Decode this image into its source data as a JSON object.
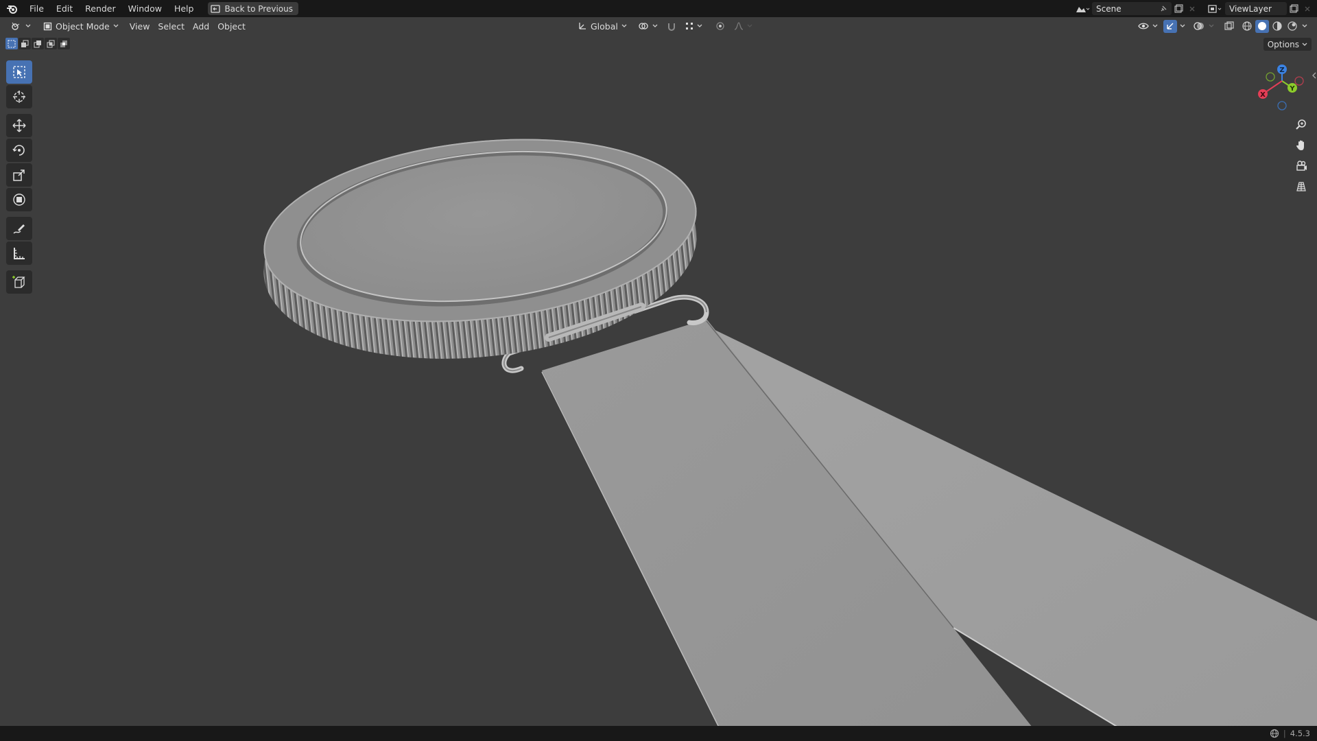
{
  "menu": {
    "items": [
      "File",
      "Edit",
      "Render",
      "Window",
      "Help"
    ],
    "back_label": "Back to Previous"
  },
  "topbar_right": {
    "scene": "Scene",
    "view_layer": "ViewLayer"
  },
  "header": {
    "mode": "Object Mode",
    "menus": [
      "View",
      "Select",
      "Add",
      "Object"
    ],
    "orientation": "Global",
    "options_label": "Options"
  },
  "toolbar": {
    "tools": [
      "select-box",
      "cursor",
      "move",
      "rotate",
      "scale",
      "transform",
      "annotate",
      "measure",
      "add-cube"
    ],
    "active": "select-box"
  },
  "gizmo": {
    "axes": [
      "Z",
      "Y",
      "X"
    ]
  },
  "status": {
    "version": "4.5.3"
  },
  "colors": {
    "accent": "#4772b3",
    "viewport_bg": "#3d3d3d",
    "header_bg": "#181818",
    "axis_x": "#e53e56",
    "axis_y": "#8ccc2b",
    "axis_z": "#3b83e4"
  }
}
